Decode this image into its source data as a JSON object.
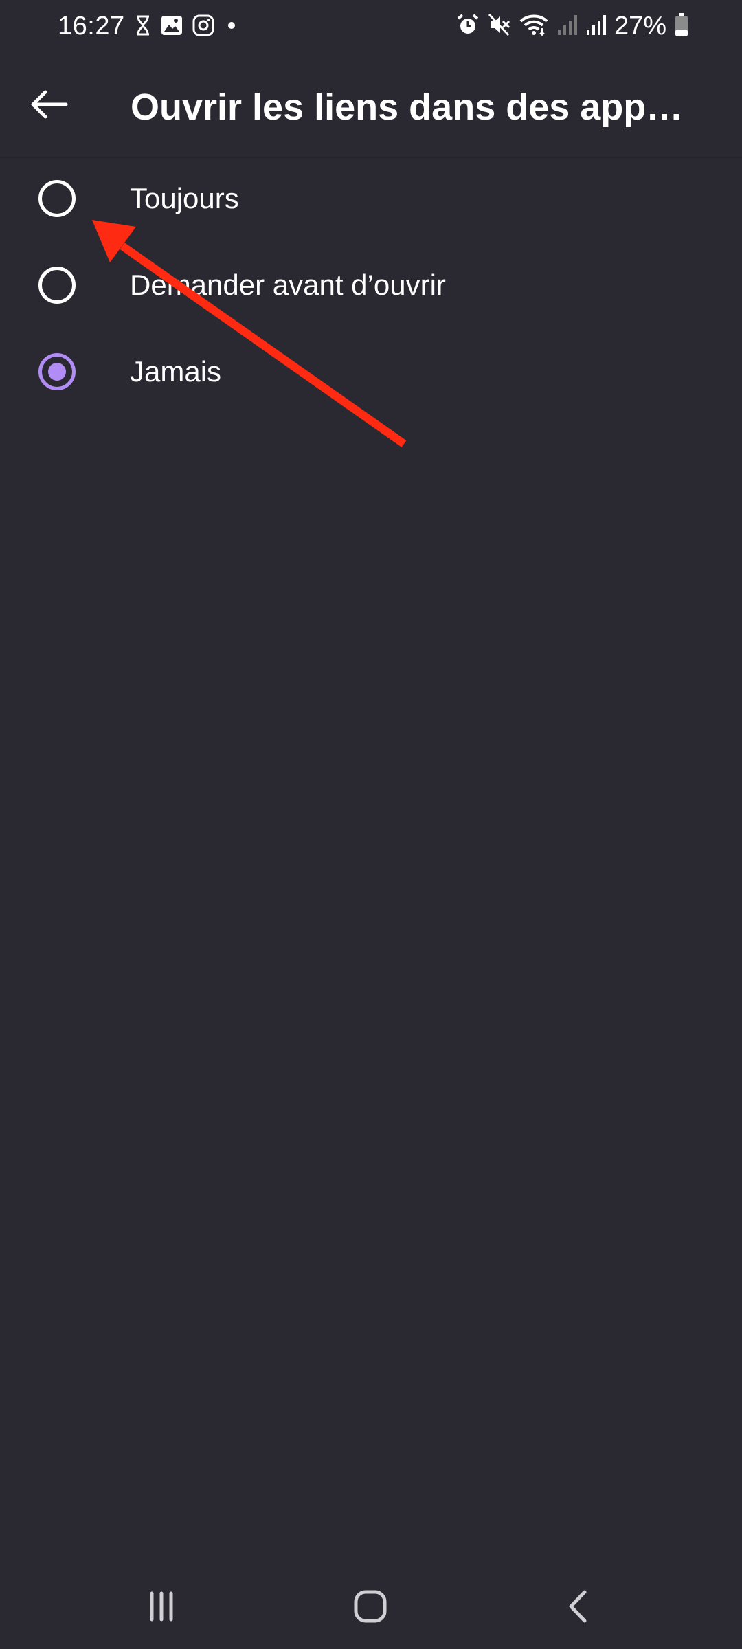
{
  "status_bar": {
    "time": "16:27",
    "battery_percent": "27%",
    "left_icons": [
      "hourglass-icon",
      "gallery-icon",
      "instagram-icon",
      "dot-icon"
    ],
    "right_icons": [
      "alarm-icon",
      "mute-icon",
      "wifi-icon",
      "signal-icon",
      "signal-icon",
      "battery-icon"
    ],
    "battery_level": 0.27
  },
  "app_bar": {
    "back_icon": "arrow-back-icon",
    "title": "Ouvrir les liens dans des app…"
  },
  "options": [
    {
      "label": "Toujours",
      "selected": false
    },
    {
      "label": "Demander avant d’ouvrir",
      "selected": false
    },
    {
      "label": "Jamais",
      "selected": true
    }
  ],
  "nav_bar": {
    "buttons": [
      "recent-apps-icon",
      "home-icon",
      "back-icon"
    ]
  },
  "colors": {
    "background": "#2a2932",
    "accent": "#b28cf5",
    "annotation_arrow": "#ff2a12"
  }
}
